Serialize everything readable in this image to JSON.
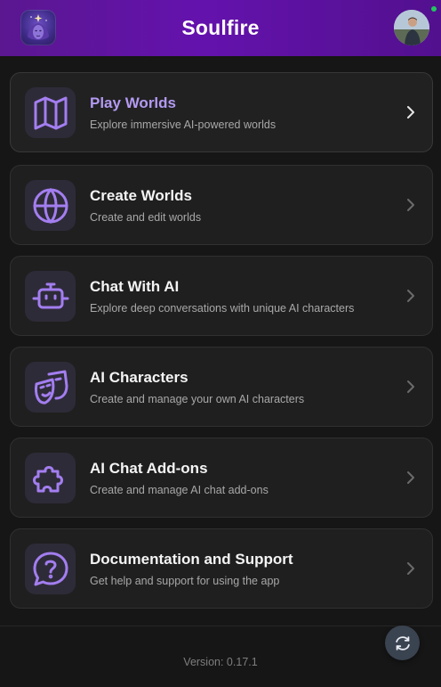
{
  "header": {
    "title": "Soulfire"
  },
  "menu": {
    "items": [
      {
        "title": "Play Worlds",
        "subtitle": "Explore immersive AI-powered worlds",
        "icon": "map-icon"
      },
      {
        "title": "Create Worlds",
        "subtitle": "Create and edit worlds",
        "icon": "globe-icon"
      },
      {
        "title": "Chat With AI",
        "subtitle": "Explore deep conversations with unique AI characters",
        "icon": "robot-icon"
      },
      {
        "title": "AI Characters",
        "subtitle": "Create and manage your own AI characters",
        "icon": "theater-masks-icon"
      },
      {
        "title": "AI Chat Add-ons",
        "subtitle": "Create and manage AI chat add-ons",
        "icon": "puzzle-piece-icon"
      },
      {
        "title": "Documentation and Support",
        "subtitle": "Get help and support for using the app",
        "icon": "help-bubble-icon"
      }
    ]
  },
  "footer": {
    "version": "Version: 0.17.1"
  },
  "colors": {
    "accent": "#a37ef0",
    "header": "#6412ad",
    "background": "#161616",
    "status": "#22c55e"
  }
}
